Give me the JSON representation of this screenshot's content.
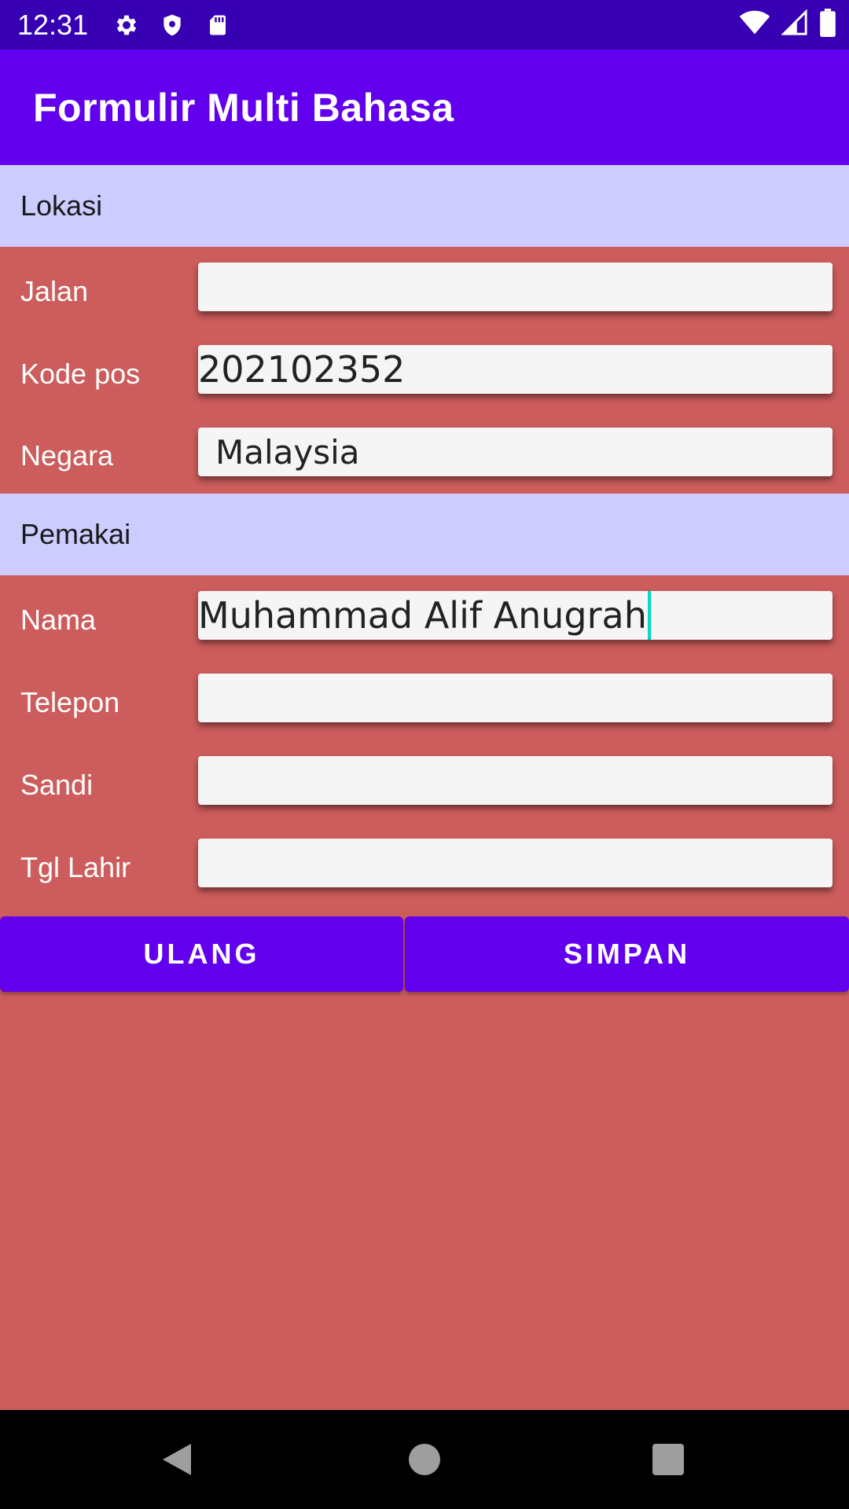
{
  "status_bar": {
    "time": "12:31",
    "left_icons": [
      "gear-icon",
      "shield-icon",
      "sd-card-icon"
    ],
    "right_icons": [
      "wifi-icon",
      "signal-icon",
      "battery-icon"
    ]
  },
  "app_bar": {
    "title": "Formulir Multi Bahasa"
  },
  "sections": {
    "location": {
      "title": "Lokasi"
    },
    "user": {
      "title": "Pemakai"
    }
  },
  "fields": {
    "street": {
      "label": "Jalan",
      "value": ""
    },
    "postal_code": {
      "label": "Kode pos",
      "value": "202102352"
    },
    "country": {
      "label": "Negara",
      "value": "Malaysia"
    },
    "name": {
      "label": "Nama",
      "value": "Muhammad Alif Anugrah"
    },
    "phone": {
      "label": "Telepon",
      "value": ""
    },
    "password": {
      "label": "Sandi",
      "value": ""
    },
    "birth_date": {
      "label": "Tgl Lahir",
      "value": ""
    }
  },
  "buttons": {
    "reset": "ULANG",
    "save": "SIMPAN"
  },
  "colors": {
    "status_bar": "#3700b3",
    "primary": "#6200ee",
    "section_bg": "#ccccff",
    "form_bg": "#cd5c5c",
    "cursor": "#03dac5"
  },
  "nav_bar": {
    "icons": [
      "back-icon",
      "home-icon",
      "recents-icon"
    ]
  }
}
